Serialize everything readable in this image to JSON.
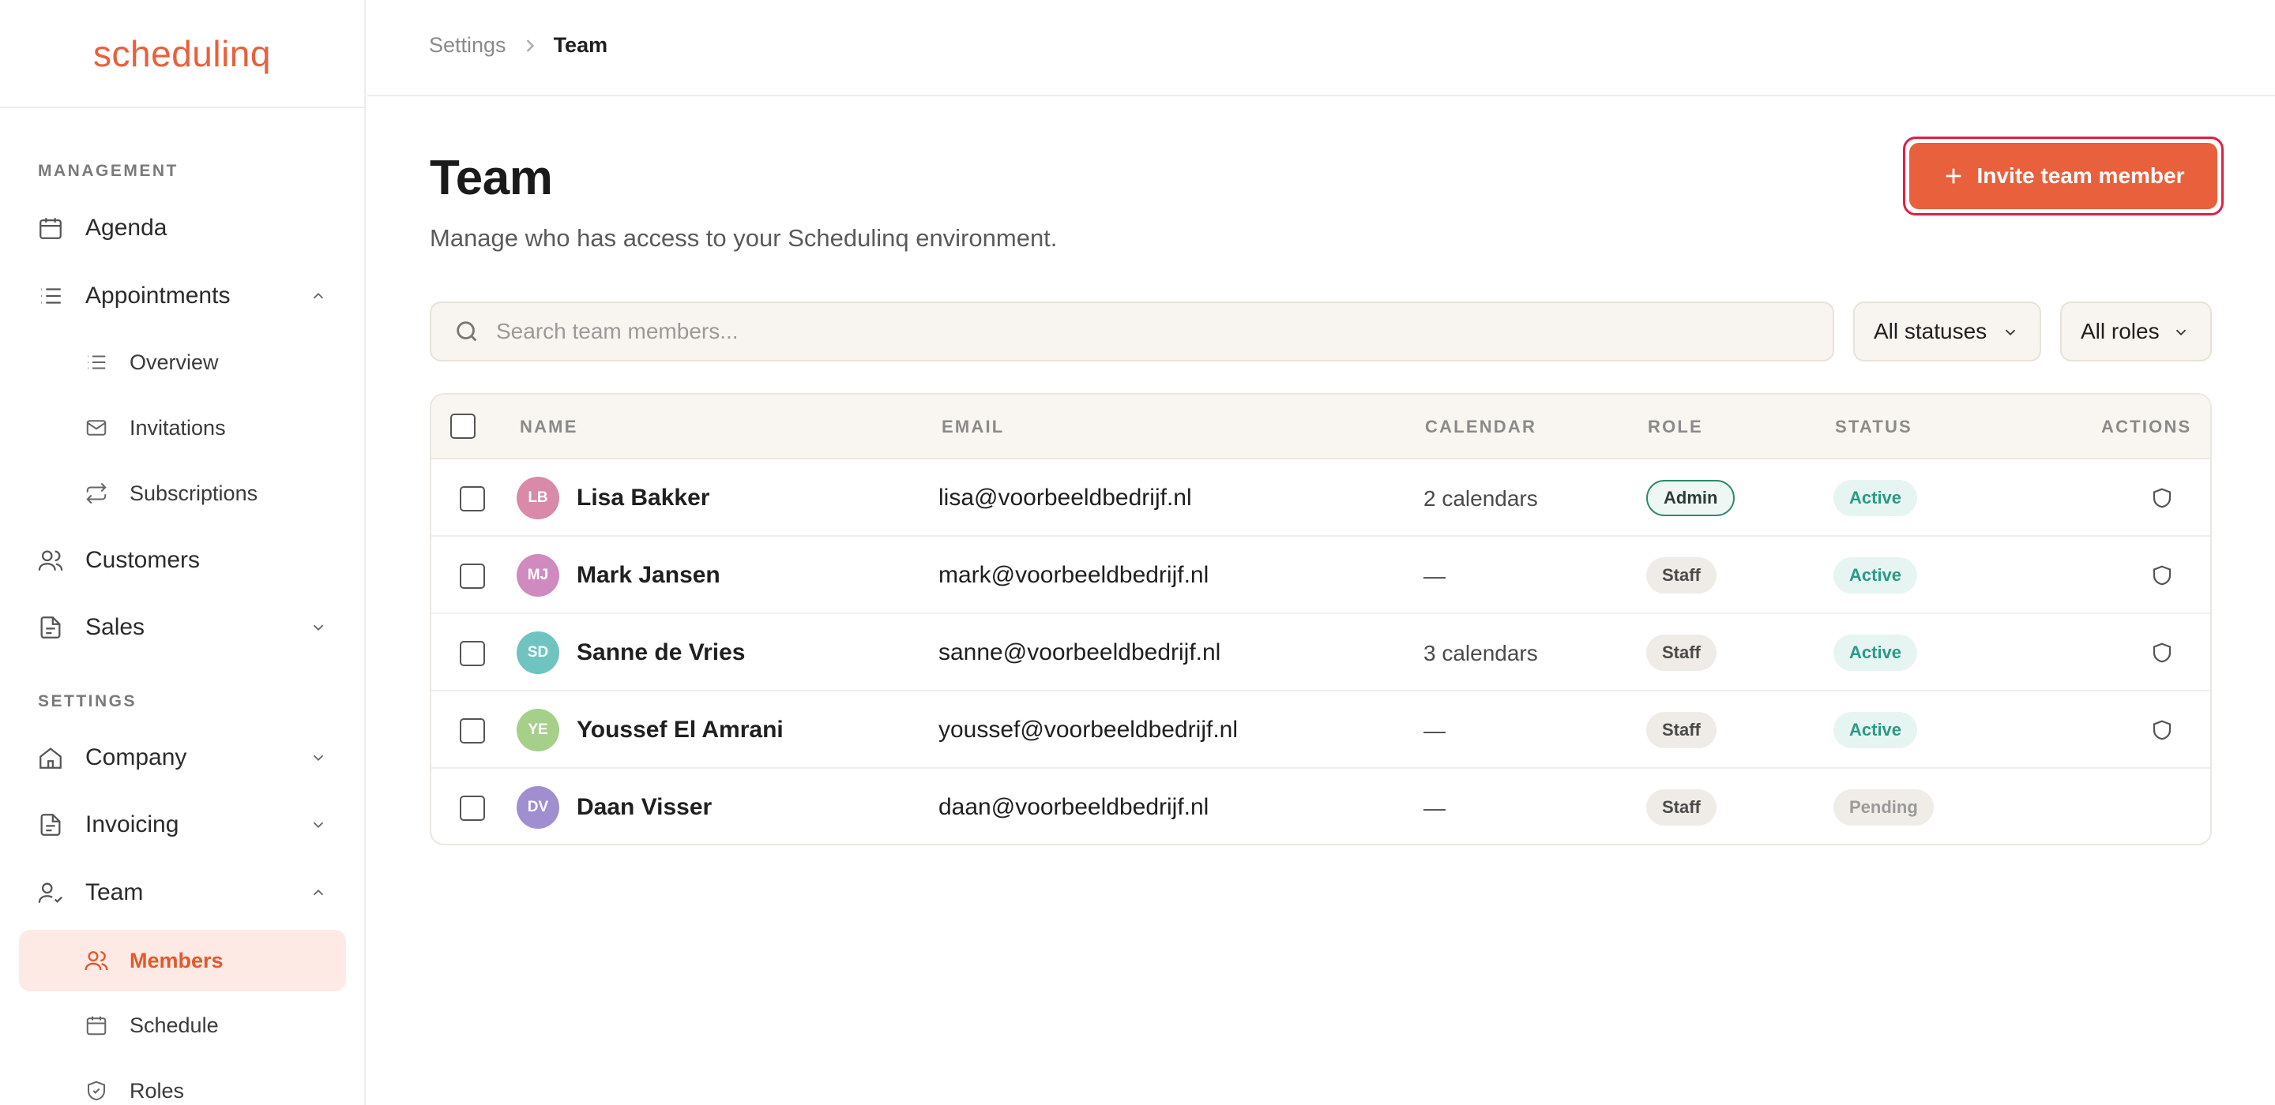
{
  "app": {
    "logo": "schedulinq"
  },
  "sidebar": {
    "sections": [
      {
        "label": "MANAGEMENT"
      },
      {
        "label": "SETTINGS"
      }
    ],
    "items": {
      "agenda": "Agenda",
      "appointments": "Appointments",
      "overview": "Overview",
      "invitations": "Invitations",
      "subscriptions": "Subscriptions",
      "customers": "Customers",
      "sales": "Sales",
      "company": "Company",
      "invoicing": "Invoicing",
      "team": "Team",
      "members": "Members",
      "schedule": "Schedule",
      "roles": "Roles"
    }
  },
  "breadcrumb": {
    "root": "Settings",
    "current": "Team"
  },
  "page": {
    "title": "Team",
    "subtitle": "Manage who has access to your Schedulinq environment.",
    "invite_label": "Invite team member"
  },
  "search": {
    "placeholder": "Search team members..."
  },
  "filters": {
    "status": "All statuses",
    "role": "All roles"
  },
  "table": {
    "headers": [
      "NAME",
      "EMAIL",
      "CALENDAR",
      "ROLE",
      "STATUS",
      "ACTIONS"
    ],
    "rows": [
      {
        "initials": "LB",
        "name": "Lisa Bakker",
        "email": "lisa@voorbeeldbedrijf.nl",
        "calendar": "2 calendars",
        "role": "Admin",
        "status": "Active",
        "avatar_color": "#d98aa8"
      },
      {
        "initials": "MJ",
        "name": "Mark Jansen",
        "email": "mark@voorbeeldbedrijf.nl",
        "calendar": "—",
        "role": "Staff",
        "status": "Active",
        "avatar_color": "#cf8bc0"
      },
      {
        "initials": "SD",
        "name": "Sanne de Vries",
        "email": "sanne@voorbeeldbedrijf.nl",
        "calendar": "3 calendars",
        "role": "Staff",
        "status": "Active",
        "avatar_color": "#6fc3c0"
      },
      {
        "initials": "YE",
        "name": "Youssef El Amrani",
        "email": "youssef@voorbeeldbedrijf.nl",
        "calendar": "—",
        "role": "Staff",
        "status": "Active",
        "avatar_color": "#a6cf8a"
      },
      {
        "initials": "DV",
        "name": "Daan Visser",
        "email": "daan@voorbeeldbedrijf.nl",
        "calendar": "—",
        "role": "Staff",
        "status": "Pending",
        "avatar_color": "#a08fd0"
      }
    ]
  },
  "colors": {
    "accent": "#e8603c",
    "focus_ring": "#e01e4a",
    "active_green": "#2a9a86"
  },
  "icons": {
    "agenda": "calendar-icon",
    "appointments": "list-icon",
    "overview": "list-icon",
    "invitations": "mail-icon",
    "subscriptions": "repeat-icon",
    "customers": "users-icon",
    "sales": "document-icon",
    "company": "building-icon",
    "invoicing": "document-icon",
    "team": "user-check-icon",
    "members": "users-icon",
    "schedule": "calendar-icon",
    "roles": "shield-check-icon",
    "action": "shield-icon"
  }
}
